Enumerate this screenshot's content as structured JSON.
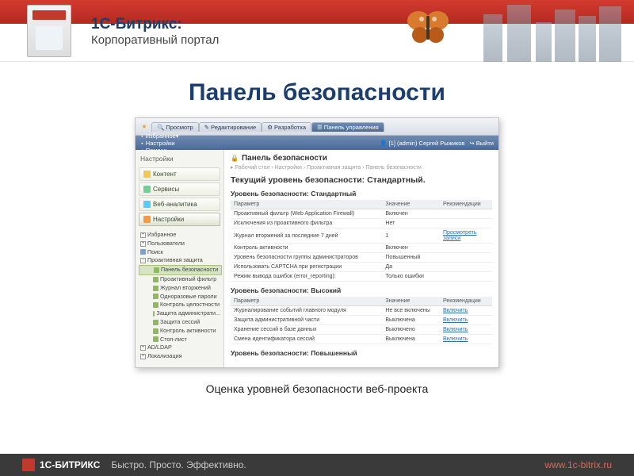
{
  "brand": {
    "title": "1С-Битрикс:",
    "subtitle": "Корпоративный портал"
  },
  "page_title": "Панель безопасности",
  "caption": "Оценка уровней безопасности веб-проекта",
  "footer": {
    "brand": "1С-БИТРИКС",
    "tagline": "Быстро. Просто. Эффективно.",
    "url": "www.1c-bitrix.ru"
  },
  "toolbar_tabs": [
    "Просмотр",
    "Редактирование",
    "Разработка",
    "Панель управления"
  ],
  "toolbar2": {
    "items": [
      "Избранное▾",
      "Настройки",
      "Помощь"
    ],
    "right": [
      "[1] (admin) Сергей Рыжиков",
      "Выйти"
    ]
  },
  "sidebar": {
    "title": "Настройки",
    "buttons": [
      "Контент",
      "Сервисы",
      "Веб-аналитика",
      "Настройки"
    ],
    "tree": [
      {
        "t": "Избранное",
        "sq": "+",
        "ind": 0
      },
      {
        "t": "Пользователи",
        "sq": "+",
        "ind": 0
      },
      {
        "t": "Поиск",
        "ind": 0,
        "icon": "#7aa0d0"
      },
      {
        "t": "Проактивная защита",
        "sq": "-",
        "ind": 0
      },
      {
        "t": "Панель безопасности",
        "ind": 2,
        "hl": true,
        "icon": "#8fb860"
      },
      {
        "t": "Проактивный фильтр",
        "ind": 2,
        "icon": "#8fb860"
      },
      {
        "t": "Журнал вторжений",
        "ind": 2,
        "icon": "#8fb860"
      },
      {
        "t": "Одноразовые пароли",
        "ind": 2,
        "icon": "#8fb860"
      },
      {
        "t": "Контроль целостности",
        "ind": 2,
        "icon": "#8fb860"
      },
      {
        "t": "Защита администрати...",
        "ind": 2,
        "icon": "#8fb860"
      },
      {
        "t": "Защита сессий",
        "ind": 2,
        "icon": "#8fb860"
      },
      {
        "t": "Контроль активности",
        "ind": 2,
        "icon": "#8fb860"
      },
      {
        "t": "Стоп-лист",
        "ind": 2,
        "icon": "#8fb860"
      },
      {
        "t": "AD/LDAP",
        "sq": "+",
        "ind": 0
      },
      {
        "t": "Локализация",
        "sq": "+",
        "ind": 0
      }
    ]
  },
  "panel": {
    "title": "Панель безопасности",
    "breadcrumb": "Рабочий стол › Настройки › Проактивная защита › Панель безопасности",
    "current_level": "Текущий уровень безопасности: Стандартный.",
    "sections": [
      {
        "heading": "Уровень безопасности: Стандартный",
        "cols": [
          "Параметр",
          "Значение",
          "Рекомендации"
        ],
        "rows": [
          [
            "Проактивный фильтр (Web Application Firewall)",
            "Включен",
            ""
          ],
          [
            "Исключения из проактивного фильтра",
            "Нет",
            ""
          ],
          [
            "Журнал вторжений за последние 7 дней",
            "1",
            "Просмотреть записи"
          ],
          [
            "Контроль активности",
            "Включен",
            ""
          ],
          [
            "Уровень безопасности группы администраторов",
            "Повышенный",
            ""
          ],
          [
            "Использовать CAPTCHA при регистрации",
            "Да",
            ""
          ],
          [
            "Режим вывода ошибок (error_reporting):",
            "Только ошибки",
            ""
          ]
        ]
      },
      {
        "heading": "Уровень безопасности: Высокий",
        "cols": [
          "Параметр",
          "Значение",
          "Рекомендации"
        ],
        "rows": [
          [
            "Журналирование событий главного модуля",
            "Не все включены",
            "Включить"
          ],
          [
            "Защита административной части",
            "Выключена",
            "Включить"
          ],
          [
            "Хранение сессий в базе данных",
            "Выключено",
            "Включить"
          ],
          [
            "Смена идентификатора сессий",
            "Выключена",
            "Включить"
          ]
        ]
      },
      {
        "heading": "Уровень безопасности: Повышенный",
        "cols": [],
        "rows": []
      }
    ]
  }
}
